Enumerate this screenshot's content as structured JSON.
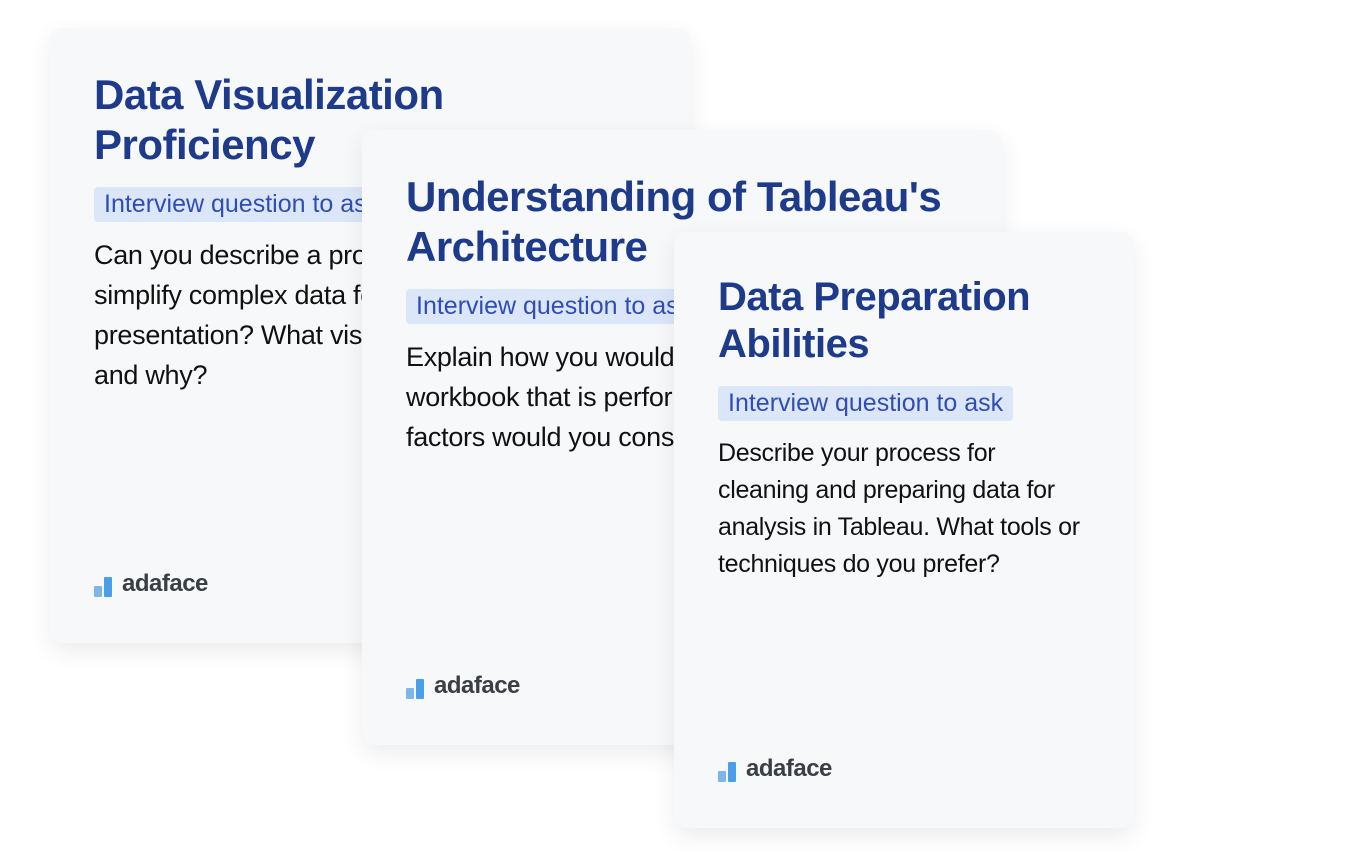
{
  "cards": [
    {
      "title": "Data Visualization Proficiency",
      "badge": "Interview question to ask",
      "body": "Can you describe a project where you had to simplify complex data for a stakeholder presentation? What visualizations did you use and why?",
      "brand": "adaface"
    },
    {
      "title": "Understanding of Tableau's Architecture",
      "badge": "Interview question to ask",
      "body": "Explain how you would optimize a Tableau workbook that is performing slowly. What factors would you consider?",
      "brand": "adaface"
    },
    {
      "title": "Data Preparation Abilities",
      "badge": "Interview question to ask",
      "body": "Describe your process for cleaning and preparing data for analysis in Tableau. What tools or techniques do you prefer?",
      "brand": "adaface"
    }
  ]
}
